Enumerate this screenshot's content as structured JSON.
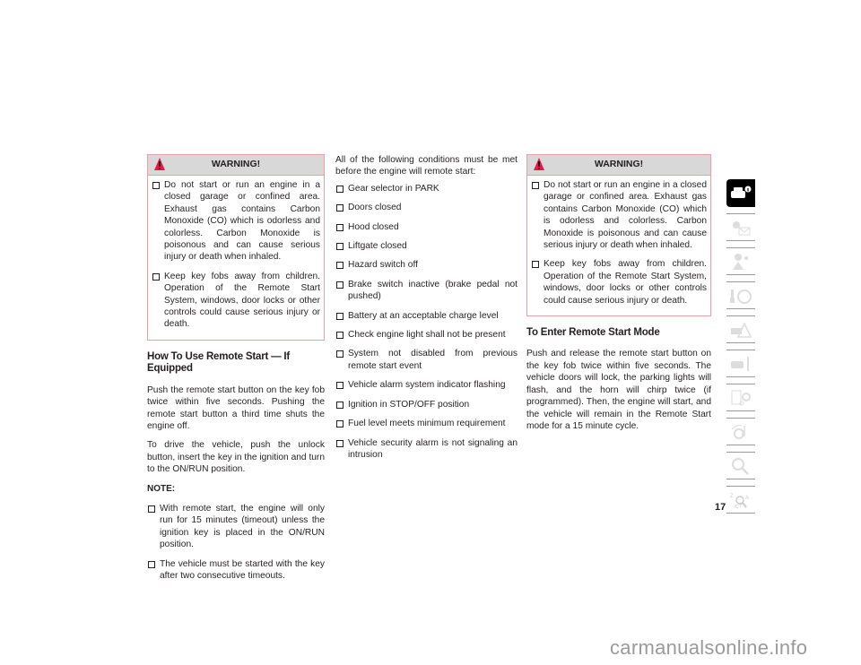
{
  "col1": {
    "warning": {
      "title": "WARNING!",
      "items": [
        "Do not start or run an engine in a closed garage or confined area. Exhaust gas contains Carbon Monoxide (CO) which is odorless and colorless. Carbon Monoxide is poisonous and can cause serious injury or death when inhaled.",
        "Keep key fobs away from children. Operation of the Remote Start System, windows, door locks or other controls could cause serious injury or death."
      ]
    },
    "heading": "How To Use Remote Start — If Equipped",
    "paragraphs": [
      "Push the remote start button on the key fob twice within five seconds. Pushing the remote start button a third time shuts the engine off.",
      "To drive the vehicle, push the unlock button, insert the key in the ignition and turn to the ON/RUN position."
    ],
    "note_label": "NOTE:",
    "notes": [
      "With remote start, the engine will only run for 15 minutes (timeout) unless the ignition key is placed in the ON/RUN position.",
      "The vehicle must be started with the key after two consecutive timeouts."
    ]
  },
  "col2": {
    "intro": "All of the following conditions must be met before the engine will remote start:",
    "conditions": [
      "Gear selector in PARK",
      "Doors closed",
      "Hood closed",
      "Liftgate closed",
      "Hazard switch off",
      "Brake switch inactive (brake pedal not pushed)",
      "Battery at an acceptable charge level",
      "Check engine light shall not be present",
      "System not disabled from previous remote start event",
      "Vehicle alarm system indicator flashing",
      "Ignition in STOP/OFF position",
      "Fuel level meets minimum requirement",
      "Vehicle security alarm is not signaling an intrusion"
    ]
  },
  "col3": {
    "warning": {
      "title": "WARNING!",
      "items": [
        "Do not start or run an engine in a closed garage or confined area. Exhaust gas contains Carbon Monoxide (CO) which is odorless and colorless. Carbon Monoxide is poisonous and can cause serious injury or death when inhaled.",
        "Keep key fobs away from children. Operation of the Remote Start System, windows, door locks or other controls could cause serious injury or death."
      ]
    },
    "heading": "To Enter Remote Start Mode",
    "paragraph": "Push and release the remote start button on the key fob twice within five seconds. The vehicle doors will lock, the parking lights will flash, and the horn will chirp twice (if programmed). Then, the engine will start, and the vehicle will remain in the Remote Start mode for a 15 minute cycle."
  },
  "tabs": [
    {
      "icon": "car-info-icon",
      "active": true
    },
    {
      "icon": "warning-lights-messages-icon",
      "active": false
    },
    {
      "icon": "airbag-safety-icon",
      "active": false
    },
    {
      "icon": "key-steering-wheel-icon",
      "active": false
    },
    {
      "icon": "emergency-triangle-car-icon",
      "active": false
    },
    {
      "icon": "car-wrench-service-icon",
      "active": false
    },
    {
      "icon": "specifications-gear-icon",
      "active": false
    },
    {
      "icon": "multimedia-icon",
      "active": false
    },
    {
      "icon": "search-index-icon",
      "active": false
    },
    {
      "icon": "languages-index-icon",
      "active": false
    }
  ],
  "page_number": "17",
  "watermark": "carmanualsonline.info",
  "colors": {
    "warning_border": "#e8a0a6",
    "warning_header": "#d8d8d8",
    "warning_triangle": "#e8174a"
  }
}
